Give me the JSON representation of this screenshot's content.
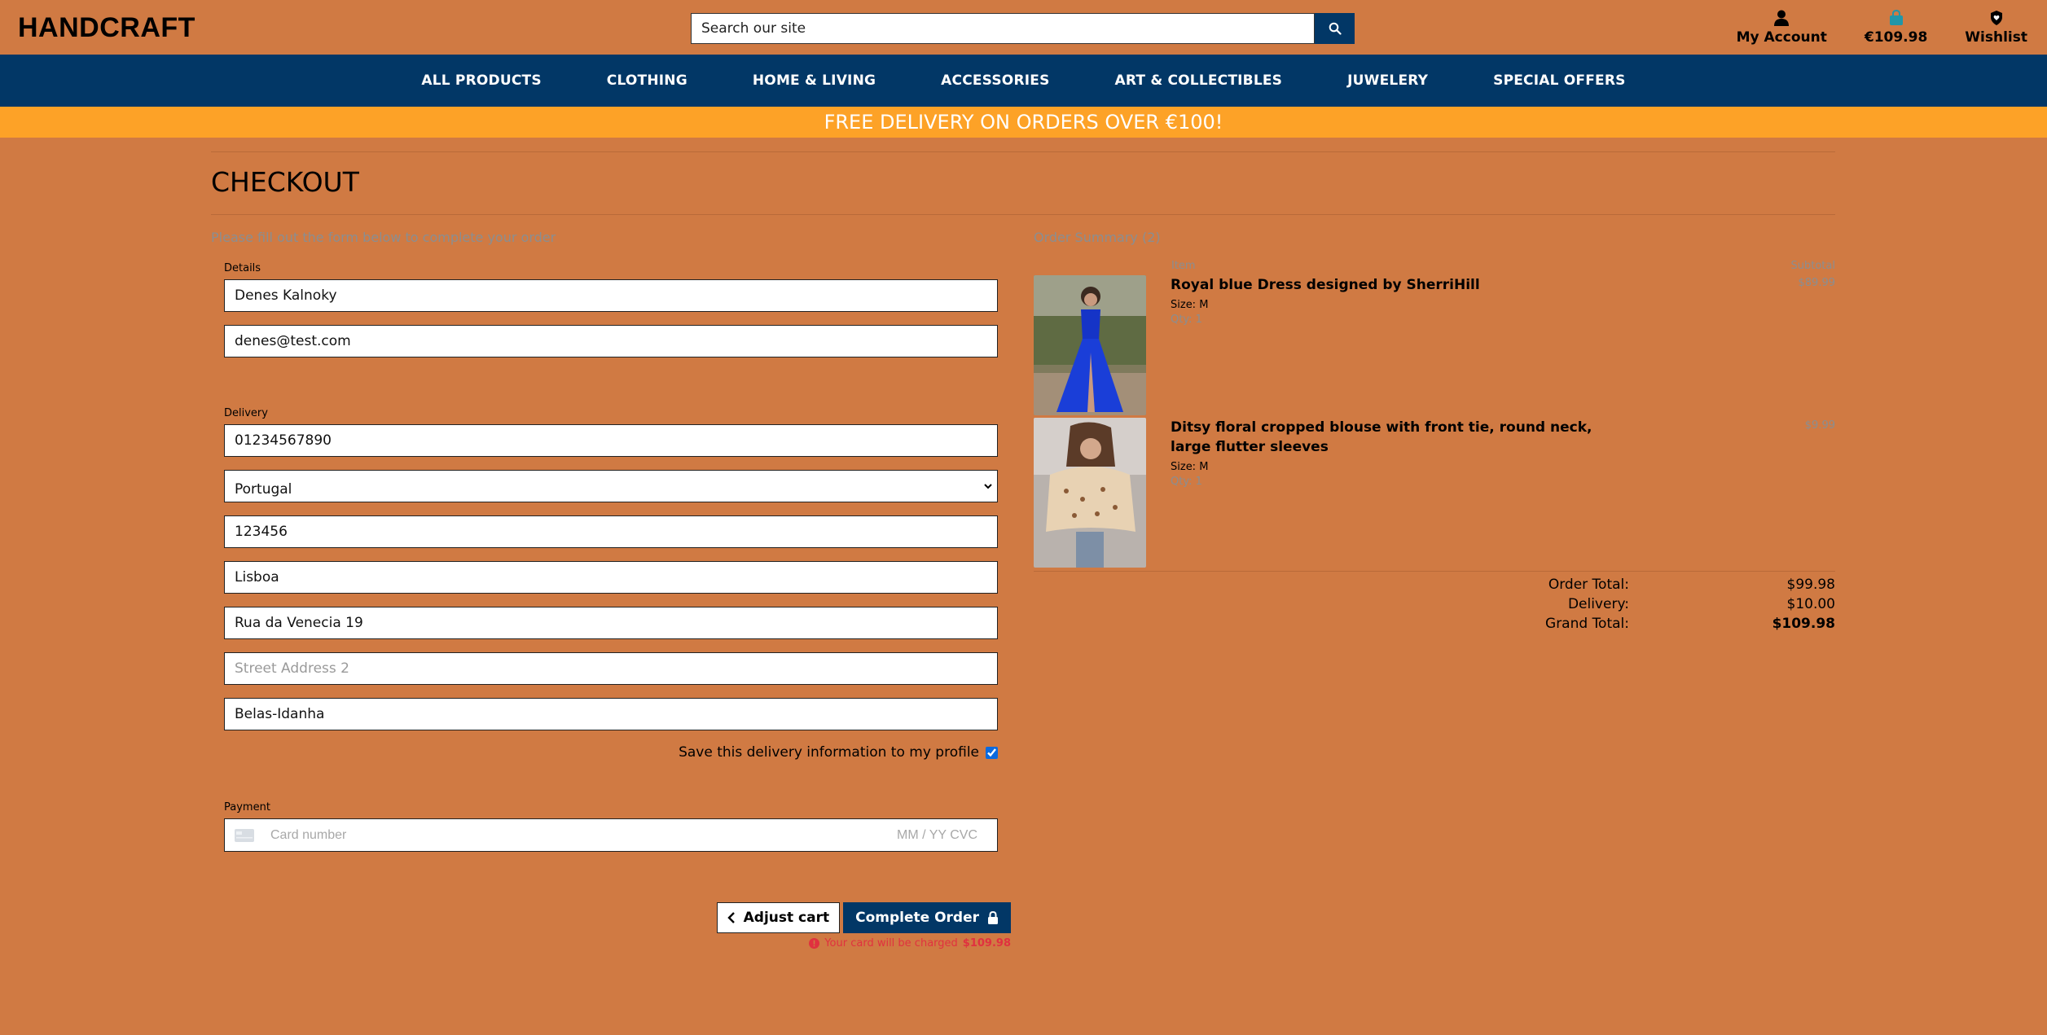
{
  "header": {
    "brand": "HANDCRAFT",
    "search_placeholder": "Search our site",
    "account_label": "My Account",
    "cart_label": "€109.98",
    "wishlist_label": "Wishlist"
  },
  "nav": [
    "ALL PRODUCTS",
    "CLOTHING",
    "HOME & LIVING",
    "ACCESSORIES",
    "ART & COLLECTIBLES",
    "JUWELERY",
    "SPECIAL OFFERS"
  ],
  "promo": "FREE DELIVERY ON ORDERS OVER €100!",
  "page_title": "CHECKOUT",
  "form": {
    "intro": "Please fill out the form below to complete your order",
    "details_label": "Details",
    "full_name": "Denes Kalnoky",
    "email": "denes@test.com",
    "delivery_label": "Delivery",
    "phone": "01234567890",
    "country": "Portugal",
    "postcode": "123456",
    "town": "Lisboa",
    "street1": "Rua da Venecia 19",
    "street2_placeholder": "Street Address 2",
    "county": "Belas-Idanha",
    "save_label": "Save this delivery information to my profile",
    "payment_label": "Payment",
    "card_placeholder": "Card number",
    "card_exp_placeholder": "MM / YY  CVC",
    "adjust_label": "Adjust cart",
    "complete_label": "Complete Order",
    "charge_text": "Your card will be charged",
    "charge_amount": "$109.98"
  },
  "summary": {
    "title": "Order Summary (2)",
    "col_item": "Item",
    "col_subtotal": "Subtotal",
    "items": [
      {
        "name": "Royal blue Dress designed by SherriHill",
        "size": "Size: M",
        "qty": "Qty: 1",
        "price": "$89.99"
      },
      {
        "name": "Ditsy floral cropped blouse with front tie, round neck, large flutter sleeves",
        "size": "Size: M",
        "qty": "Qty: 1",
        "price": "$9.99"
      }
    ],
    "order_total_label": "Order Total:",
    "order_total": "$99.98",
    "delivery_label": "Delivery:",
    "delivery": "$10.00",
    "grand_total_label": "Grand Total:",
    "grand_total": "$109.98"
  },
  "colors": {
    "navy": "#023766",
    "page": "#d07a43",
    "promo": "#fda227"
  }
}
